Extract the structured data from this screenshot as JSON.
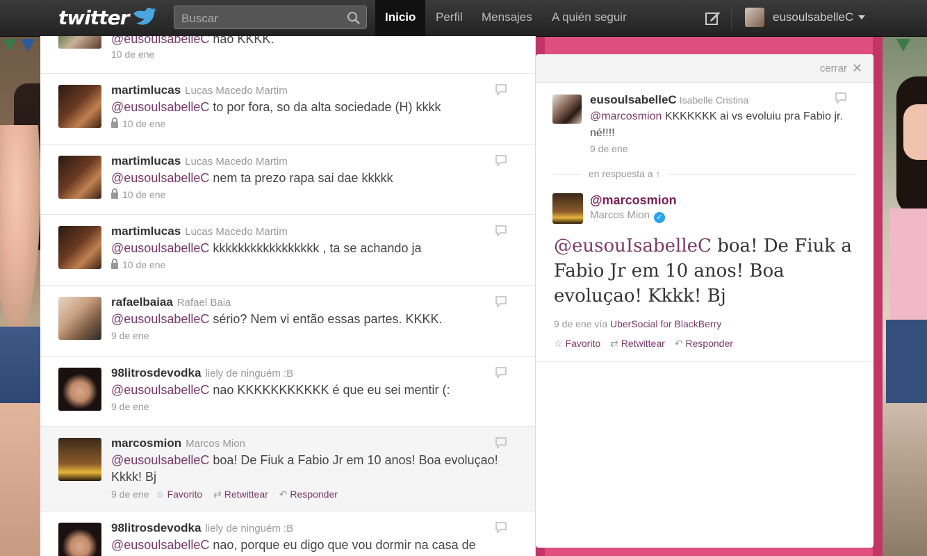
{
  "topbar": {
    "logo": "twitter",
    "search_placeholder": "Buscar",
    "nav": [
      "Inicio",
      "Perfil",
      "Mensajes",
      "A quién seguir"
    ],
    "user": "eusoulsabelleC",
    "icons": [
      "bird-icon",
      "search-icon",
      "compose-icon",
      "caret-down-icon"
    ]
  },
  "timeline": [
    {
      "text_rest": " nao KKKK.",
      "mention": "@eusoulsabelleC",
      "time": "10 de ene"
    },
    {
      "user": "martimlucas",
      "name": "Lucas Macedo Martim",
      "mention": "@eusoulsabelleC",
      "text_rest": " to por fora, so da alta sociedade (H) kkkk",
      "time": "10 de ene"
    },
    {
      "user": "martimlucas",
      "name": "Lucas Macedo Martim",
      "mention": "@eusoulsabelleC",
      "text_rest": " nem ta prezo rapa sai dae kkkkk",
      "time": "10 de ene"
    },
    {
      "user": "martimlucas",
      "name": "Lucas Macedo Martim",
      "mention": "@eusoulsabelleC",
      "text_rest": " kkkkkkkkkkkkkkkkk , ta se achando ja",
      "time": "10 de ene"
    },
    {
      "user": "rafaelbaiaa",
      "name": "Rafael Baia",
      "mention": "@eusoulsabelleC",
      "text_rest": " sério? Nem vi então essas partes. KKKK.",
      "time": "9 de ene"
    },
    {
      "user": "98litrosdevodka",
      "name": "liely de ninguém :B",
      "mention": "@eusoulsabelleC",
      "text_rest": " nao KKKKKKKKKKK é que eu sei mentir (:",
      "time": "9 de ene"
    },
    {
      "user": "marcosmion",
      "name": "Marcos Mion",
      "mention": "@eusoulsabelleC",
      "text_rest": " boa! De Fiuk a Fabio Jr em 10 anos! Boa evoluçao! Kkkk! Bj",
      "time": "9 de ene",
      "actions": [
        "Favorito",
        "Retwittear",
        "Responder"
      ]
    },
    {
      "user": "98litrosdevodka",
      "name": "liely de ninguém :B",
      "mention": "@eusoulsabelleC",
      "text_rest": " nao, porque eu digo que vou dormir na casa de",
      "time": ""
    }
  ],
  "pane": {
    "close": "cerrar",
    "orig": {
      "user": "eusoulsabelleC",
      "name": "Isabelle Cristina",
      "mention": "@marcosmion",
      "text_rest": " KKKKKKK ai vs evoluiu pra Fabio jr. né!!!!",
      "time": "9 de ene"
    },
    "in_reply": "en respuesta a ↑",
    "main": {
      "handle": "@marcosmion",
      "name": "Marcos Mion",
      "mention": "@eusouIsabelleC",
      "text_rest": " boa! De Fiuk a Fabio Jr em 10 anos! Boa evoluçao! Kkkk! Bj",
      "meta_time": "9 de ene",
      "meta_via": "vía",
      "source": "UberSocial for BlackBerry",
      "actions": [
        "Favorito",
        "Retwittear",
        "Responder"
      ]
    }
  }
}
